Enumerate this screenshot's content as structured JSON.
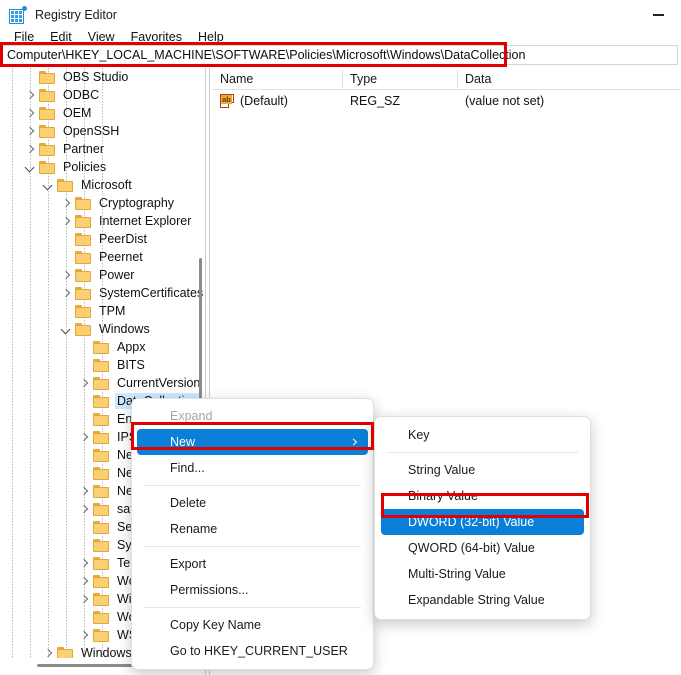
{
  "window": {
    "title": "Registry Editor",
    "app_icon": "registry-editor-icon",
    "minimize_label": "Minimize"
  },
  "menubar": {
    "items": [
      {
        "label": "File"
      },
      {
        "label": "Edit"
      },
      {
        "label": "View"
      },
      {
        "label": "Favorites"
      },
      {
        "label": "Help"
      }
    ]
  },
  "address": {
    "path": "Computer\\HKEY_LOCAL_MACHINE\\SOFTWARE\\Policies\\Microsoft\\Windows\\DataCollection",
    "highlighted": true,
    "highlight_color": "#e00000"
  },
  "tree": {
    "items": [
      {
        "label": "OBS Studio",
        "depth": 1,
        "chevron": "none",
        "selected": false
      },
      {
        "label": "ODBC",
        "depth": 1,
        "chevron": "collapsed",
        "selected": false
      },
      {
        "label": "OEM",
        "depth": 1,
        "chevron": "collapsed",
        "selected": false
      },
      {
        "label": "OpenSSH",
        "depth": 1,
        "chevron": "collapsed",
        "selected": false
      },
      {
        "label": "Partner",
        "depth": 1,
        "chevron": "collapsed",
        "selected": false
      },
      {
        "label": "Policies",
        "depth": 1,
        "chevron": "expanded",
        "selected": false
      },
      {
        "label": "Microsoft",
        "depth": 2,
        "chevron": "expanded",
        "selected": false
      },
      {
        "label": "Cryptography",
        "depth": 3,
        "chevron": "collapsed",
        "selected": false
      },
      {
        "label": "Internet Explorer",
        "depth": 3,
        "chevron": "collapsed",
        "selected": false
      },
      {
        "label": "PeerDist",
        "depth": 3,
        "chevron": "none",
        "selected": false
      },
      {
        "label": "Peernet",
        "depth": 3,
        "chevron": "none",
        "selected": false
      },
      {
        "label": "Power",
        "depth": 3,
        "chevron": "collapsed",
        "selected": false
      },
      {
        "label": "SystemCertificates",
        "depth": 3,
        "chevron": "collapsed",
        "selected": false
      },
      {
        "label": "TPM",
        "depth": 3,
        "chevron": "none",
        "selected": false
      },
      {
        "label": "Windows",
        "depth": 3,
        "chevron": "expanded",
        "selected": false
      },
      {
        "label": "Appx",
        "depth": 4,
        "chevron": "none",
        "selected": false
      },
      {
        "label": "BITS",
        "depth": 4,
        "chevron": "none",
        "selected": false
      },
      {
        "label": "CurrentVersion",
        "depth": 4,
        "chevron": "collapsed",
        "selected": false
      },
      {
        "label": "DataCollection",
        "depth": 4,
        "chevron": "none",
        "selected": true
      },
      {
        "label": "Enhan",
        "depth": 4,
        "chevron": "none",
        "selected": false
      },
      {
        "label": "IPSec",
        "depth": 4,
        "chevron": "collapsed",
        "selected": false
      },
      {
        "label": "Netwo",
        "depth": 4,
        "chevron": "none",
        "selected": false
      },
      {
        "label": "Netwo",
        "depth": 4,
        "chevron": "none",
        "selected": false
      },
      {
        "label": "Netwo",
        "depth": 4,
        "chevron": "collapsed",
        "selected": false
      },
      {
        "label": "safer",
        "depth": 4,
        "chevron": "collapsed",
        "selected": false
      },
      {
        "label": "Setting",
        "depth": 4,
        "chevron": "none",
        "selected": false
      },
      {
        "label": "Systen",
        "depth": 4,
        "chevron": "none",
        "selected": false
      },
      {
        "label": "Tenant",
        "depth": 4,
        "chevron": "collapsed",
        "selected": false
      },
      {
        "label": "WcmS",
        "depth": 4,
        "chevron": "collapsed",
        "selected": false
      },
      {
        "label": "Windc",
        "depth": 4,
        "chevron": "collapsed",
        "selected": false
      },
      {
        "label": "Workp",
        "depth": 4,
        "chevron": "none",
        "selected": false
      },
      {
        "label": "WSDAPI",
        "depth": 4,
        "chevron": "collapsed",
        "selected": false
      },
      {
        "label": "Windows Defender",
        "depth": 2,
        "chevron": "collapsed",
        "selected": false
      }
    ]
  },
  "value_list": {
    "columns": [
      "Name",
      "Type",
      "Data"
    ],
    "rows": [
      {
        "icon": "string-value-icon",
        "name": "(Default)",
        "type": "REG_SZ",
        "data": "(value not set)"
      }
    ]
  },
  "context_menu": {
    "items": [
      {
        "label": "Expand",
        "state": "disabled",
        "submenu": false,
        "separator_after": false
      },
      {
        "label": "New",
        "state": "active",
        "submenu": true,
        "separator_after": false
      },
      {
        "label": "Find...",
        "state": "normal",
        "submenu": false,
        "separator_after": true
      },
      {
        "label": "Delete",
        "state": "normal",
        "submenu": false,
        "separator_after": false
      },
      {
        "label": "Rename",
        "state": "normal",
        "submenu": false,
        "separator_after": true
      },
      {
        "label": "Export",
        "state": "normal",
        "submenu": false,
        "separator_after": false
      },
      {
        "label": "Permissions...",
        "state": "normal",
        "submenu": false,
        "separator_after": true
      },
      {
        "label": "Copy Key Name",
        "state": "normal",
        "submenu": false,
        "separator_after": false
      },
      {
        "label": "Go to HKEY_CURRENT_USER",
        "state": "normal",
        "submenu": false,
        "separator_after": false
      }
    ]
  },
  "submenu": {
    "items": [
      {
        "label": "Key",
        "state": "normal",
        "separator_after": true
      },
      {
        "label": "String Value",
        "state": "normal",
        "separator_after": false
      },
      {
        "label": "Binary Value",
        "state": "normal",
        "separator_after": false
      },
      {
        "label": "DWORD (32-bit) Value",
        "state": "active",
        "separator_after": false
      },
      {
        "label": "QWORD (64-bit) Value",
        "state": "normal",
        "separator_after": false
      },
      {
        "label": "Multi-String Value",
        "state": "normal",
        "separator_after": false
      },
      {
        "label": "Expandable String Value",
        "state": "normal",
        "separator_after": false
      }
    ]
  },
  "colors": {
    "selection_blue": "#0b7fd8",
    "tree_selection": "#cde8ff",
    "annotation_red": "#e00000",
    "folder_yellow": "#fcd072"
  }
}
